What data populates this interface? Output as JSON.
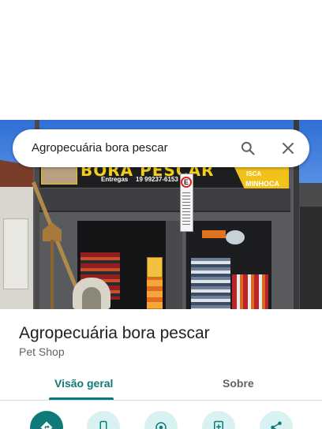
{
  "search": {
    "query": "Agropecuária bora pescar"
  },
  "photo": {
    "sign_text": "BORA PESCAR",
    "sign_small": "Entregas",
    "sign_phone": "19 99237-6153",
    "sign_right_top": "ISCA",
    "sign_right": "MINHOCA",
    "parking_letter": "E"
  },
  "place": {
    "title": "Agropecuária bora pescar",
    "category": "Pet Shop"
  },
  "tabs": [
    {
      "label": "Visão geral",
      "active": true
    },
    {
      "label": "Sobre",
      "active": false
    }
  ],
  "actions": [
    {
      "icon": "directions-icon"
    },
    {
      "icon": "phone-icon"
    },
    {
      "icon": "location-icon"
    },
    {
      "icon": "save-icon"
    },
    {
      "icon": "share-icon"
    }
  ],
  "colors": {
    "accent": "#0e7a7a",
    "accent_light": "#d8f1f1",
    "sign_yellow": "#f6cf18"
  }
}
